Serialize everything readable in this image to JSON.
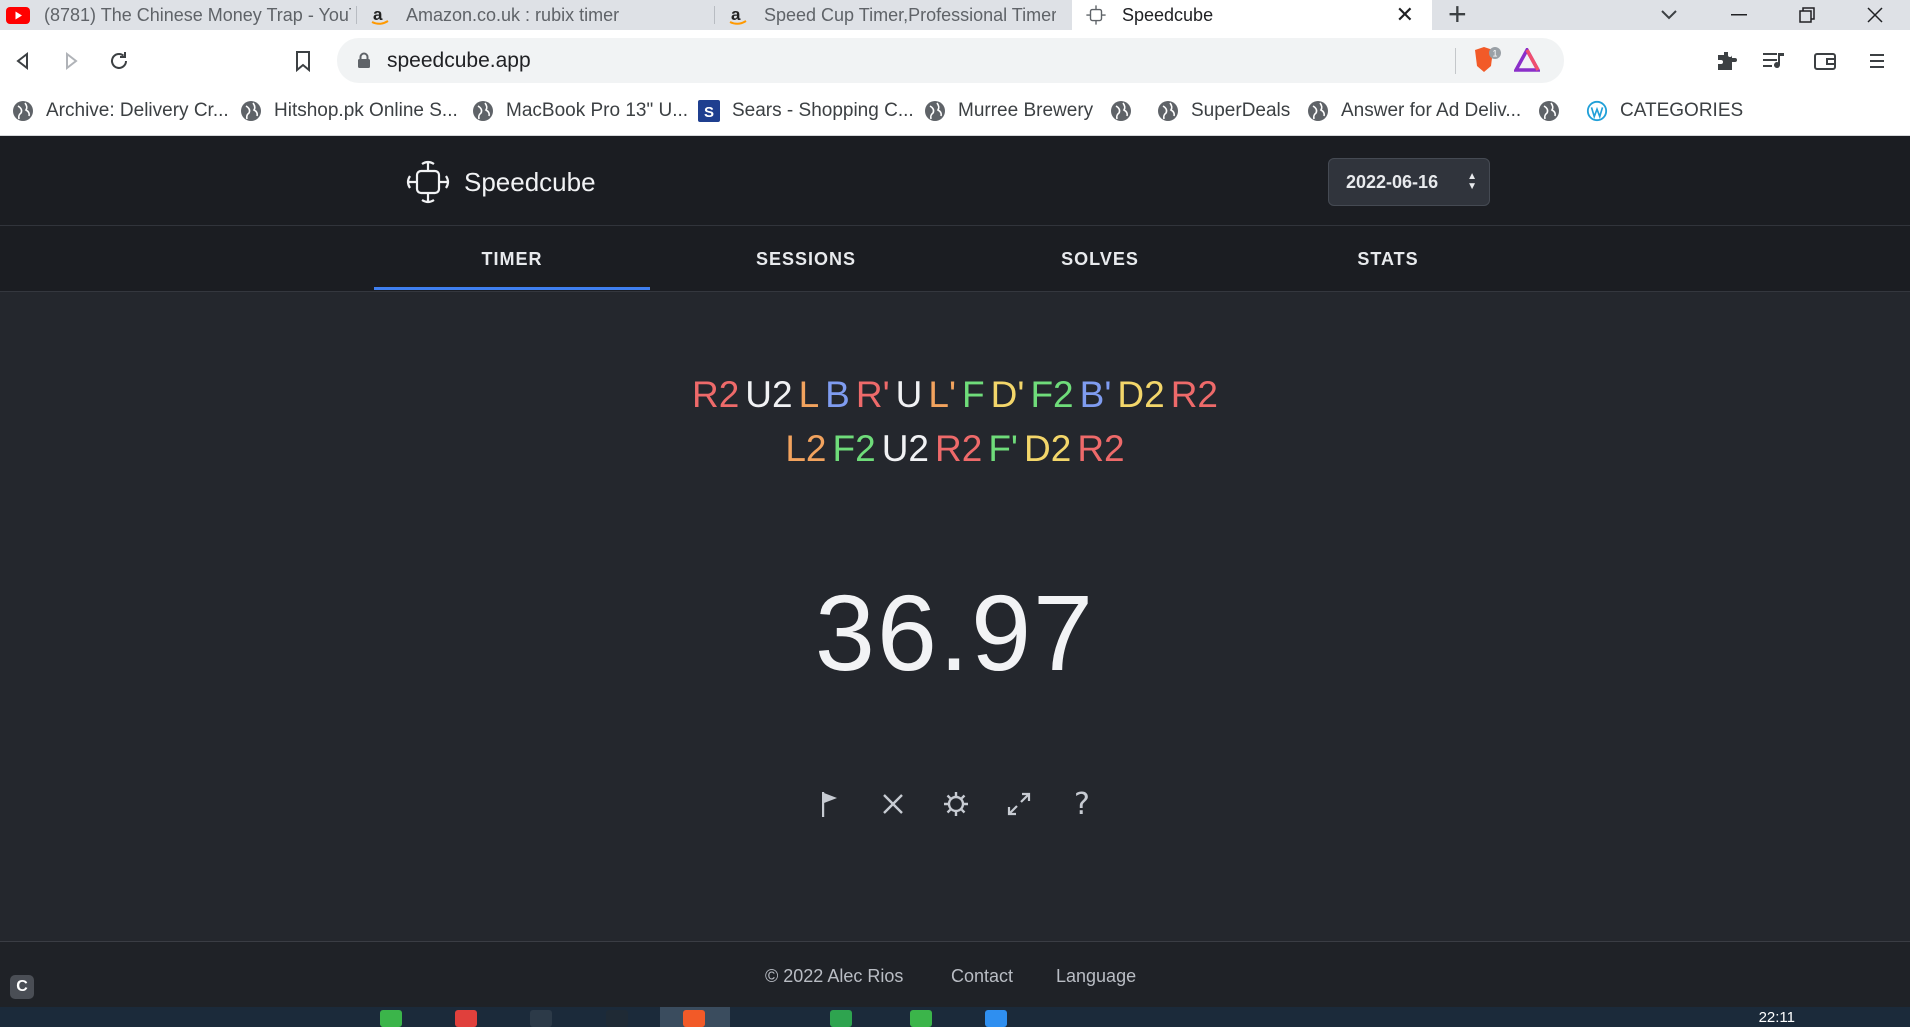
{
  "browser": {
    "tabs": [
      {
        "title": "(8781) The Chinese Money Trap - YouT",
        "icon": "youtube-icon"
      },
      {
        "title": "Amazon.co.uk : rubix timer",
        "icon": "amazon-icon"
      },
      {
        "title": "Speed Cup Timer,Professional Timer M",
        "icon": "amazon-icon"
      },
      {
        "title": "Speedcube",
        "icon": "speedcube-icon",
        "active": true
      }
    ],
    "url": "speedcube.app",
    "shield_badge": "1",
    "bookmarks": [
      {
        "label": "Archive: Delivery Cr..."
      },
      {
        "label": "Hitshop.pk Online S..."
      },
      {
        "label": "MacBook Pro 13\" U..."
      },
      {
        "label": "Sears - Shopping C..."
      },
      {
        "label": "Murree Brewery"
      },
      {
        "label": ""
      },
      {
        "label": "SuperDeals"
      },
      {
        "label": "Answer for Ad Deliv..."
      },
      {
        "label": ""
      },
      {
        "label": "CATEGORIES"
      }
    ]
  },
  "app": {
    "brand": "Speedcube",
    "session_date": "2022-06-16",
    "nav": [
      {
        "label": "TIMER",
        "active": true
      },
      {
        "label": "SESSIONS"
      },
      {
        "label": "SOLVES"
      },
      {
        "label": "STATS"
      }
    ],
    "scramble": {
      "line1": [
        "R2",
        "U2",
        "L",
        "B",
        "R'",
        "U",
        "L'",
        "F",
        "D'",
        "F2",
        "B'",
        "D2",
        "R2"
      ],
      "line2": [
        "L2",
        "F2",
        "U2",
        "R2",
        "F'",
        "D2",
        "R2"
      ]
    },
    "face_colors": {
      "R": "#ee6a6a",
      "L": "#f2a35e",
      "U": "#f1f2f4",
      "D": "#f3d66a",
      "F": "#6fdc7a",
      "B": "#7f9cf0"
    },
    "time": "36.97",
    "footer": {
      "copyright": "© 2022 Alec Rios",
      "contact": "Contact",
      "language": "Language"
    }
  },
  "taskbar": {
    "clock": "22:11"
  }
}
